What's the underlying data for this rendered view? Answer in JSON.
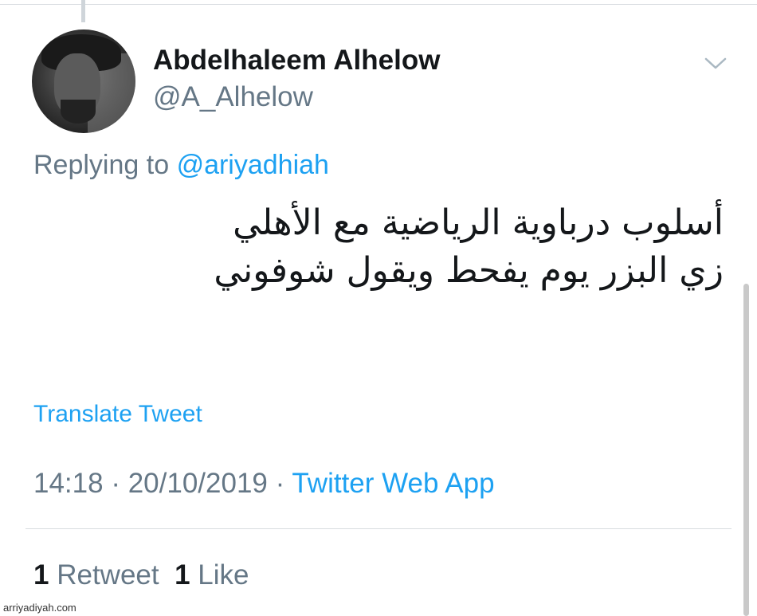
{
  "author": {
    "name": "Abdelhaleem Alhelow",
    "handle": "@A_Alhelow"
  },
  "reply": {
    "prefix": "Replying to",
    "mention": "@ariyadhiah"
  },
  "tweet": {
    "line1": "أسلوب درباوية الرياضية مع الأهلي",
    "line2": "زي البزر يوم يفحط ويقول شوفوني"
  },
  "translate_label": "Translate Tweet",
  "meta": {
    "time": "14:18",
    "sep1": " · ",
    "date": "20/10/2019",
    "sep2": " · ",
    "source": "Twitter Web App"
  },
  "stats": {
    "retweet_count": "1",
    "retweet_label": "Retweet",
    "like_count": "1",
    "like_label": "Like"
  },
  "watermark": "arriyadiyah.com",
  "icons": {
    "caret": "chevron-down-icon",
    "avatar": "profile-photo"
  },
  "colors": {
    "link": "#1da1f2",
    "muted": "#657786",
    "text": "#14171a"
  }
}
